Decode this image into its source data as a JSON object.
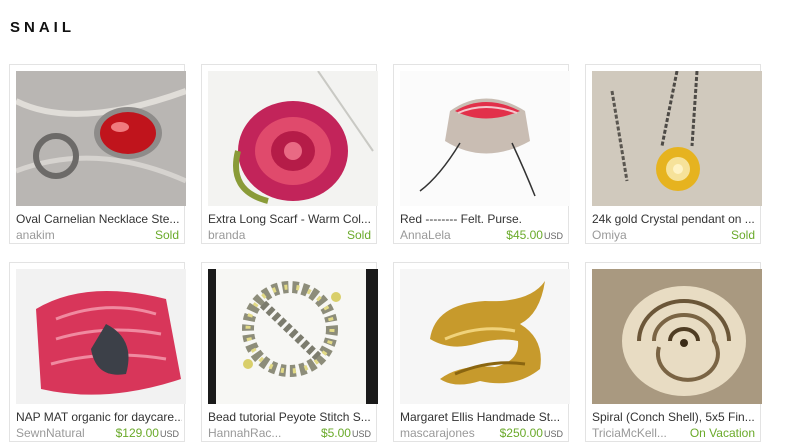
{
  "treasury": {
    "title": "SNAIL"
  },
  "colors": {
    "status_green": "#6aaa2a",
    "seller_gray": "#999999"
  },
  "items": [
    {
      "title": "Oval Carnelian Necklace Ste...",
      "seller": "anakim",
      "status": "Sold",
      "currency": ""
    },
    {
      "title": "Extra Long Scarf - Warm Col...",
      "seller": "branda",
      "status": "Sold",
      "currency": ""
    },
    {
      "title": "Red -------- Felt. Purse.",
      "seller": "AnnaLela",
      "status": "$45.00",
      "currency": "USD"
    },
    {
      "title": "24k gold Crystal pendant on ...",
      "seller": "Omiya",
      "status": "Sold",
      "currency": ""
    },
    {
      "title": "NAP MAT organic for daycare...",
      "seller": "SewnNatural",
      "status": "$129.00",
      "currency": "USD"
    },
    {
      "title": "Bead tutorial Peyote Stitch S...",
      "seller": "HannahRac...",
      "status": "$5.00",
      "currency": "USD"
    },
    {
      "title": "Margaret Ellis Handmade St...",
      "seller": "mascarajones",
      "status": "$250.00",
      "currency": "USD"
    },
    {
      "title": "Spiral (Conch Shell), 5x5 Fin...",
      "seller": "TriciaMcKell...",
      "status": "On Vacation",
      "currency": ""
    }
  ]
}
